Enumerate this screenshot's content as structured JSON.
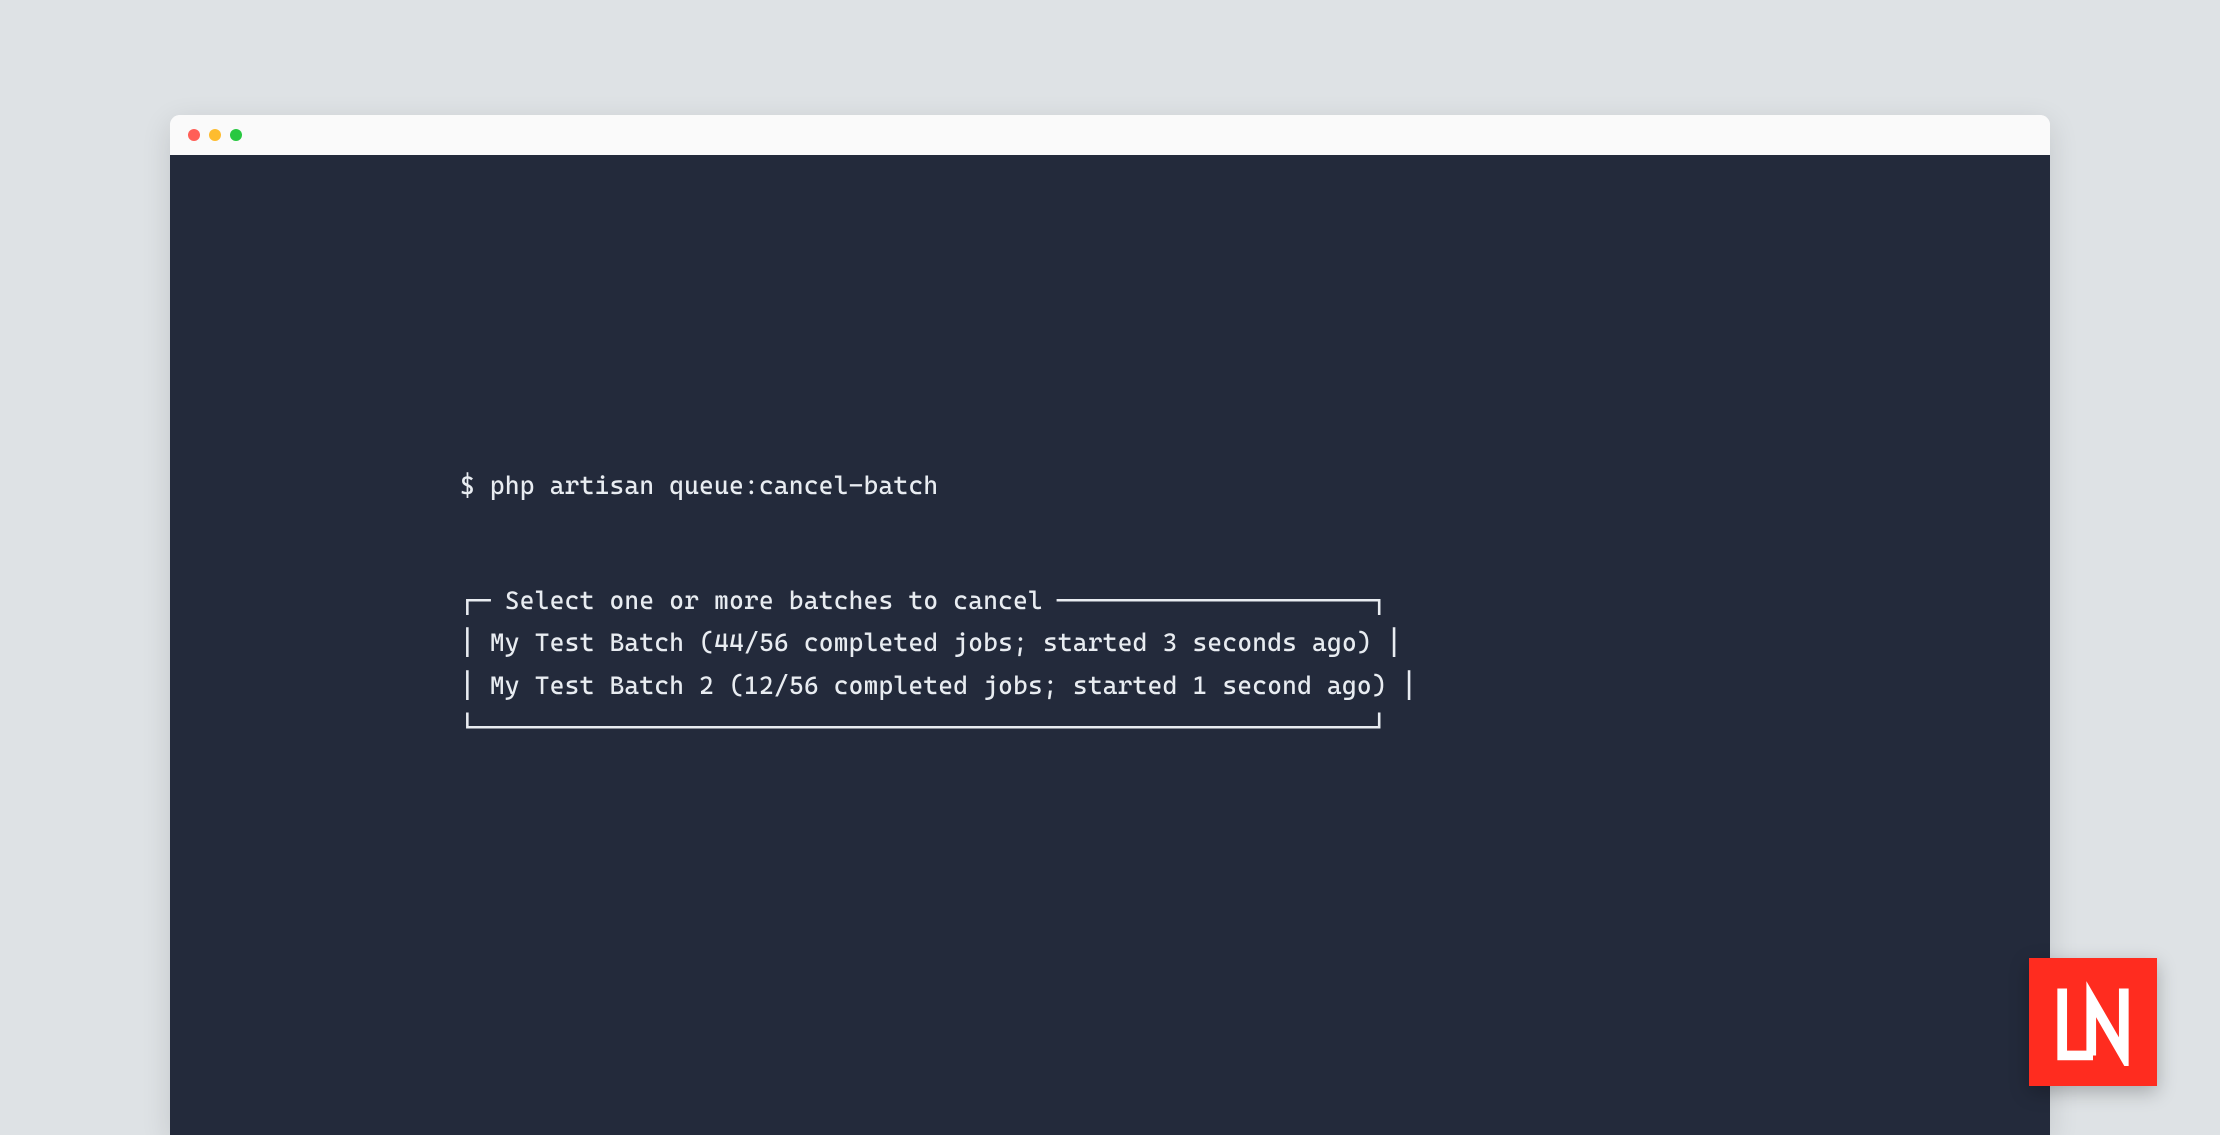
{
  "terminal": {
    "prompt": "$ php artisan queue:cancel-batch",
    "box_title": "Select one or more batches to cancel",
    "options": [
      "My Test Batch (44/56 completed jobs; started 3 seconds ago)",
      "My Test Batch 2 (12/56 completed jobs; started 1 second ago)"
    ]
  },
  "watermark": {
    "label": "LN",
    "color": "#ff2c1f"
  }
}
